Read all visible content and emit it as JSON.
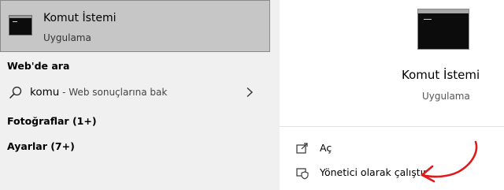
{
  "best_match": {
    "title": "Komut İstemi",
    "subtitle": "Uygulama"
  },
  "sections": {
    "web": "Web'de ara",
    "photos": "Fotoğraflar (1+)",
    "settings": "Ayarlar (7+)"
  },
  "web_search": {
    "query": "komu",
    "hint": " - Web sonuçlarına bak"
  },
  "details": {
    "title": "Komut İstemi",
    "subtitle": "Uygulama",
    "actions": [
      {
        "label": "Aç",
        "icon": "open-icon"
      },
      {
        "label": "Yönetici olarak çalıştır",
        "icon": "shield-icon"
      }
    ]
  },
  "colors": {
    "selected_bg": "#c6c6c6",
    "annotation_arrow": "#e0191b"
  }
}
